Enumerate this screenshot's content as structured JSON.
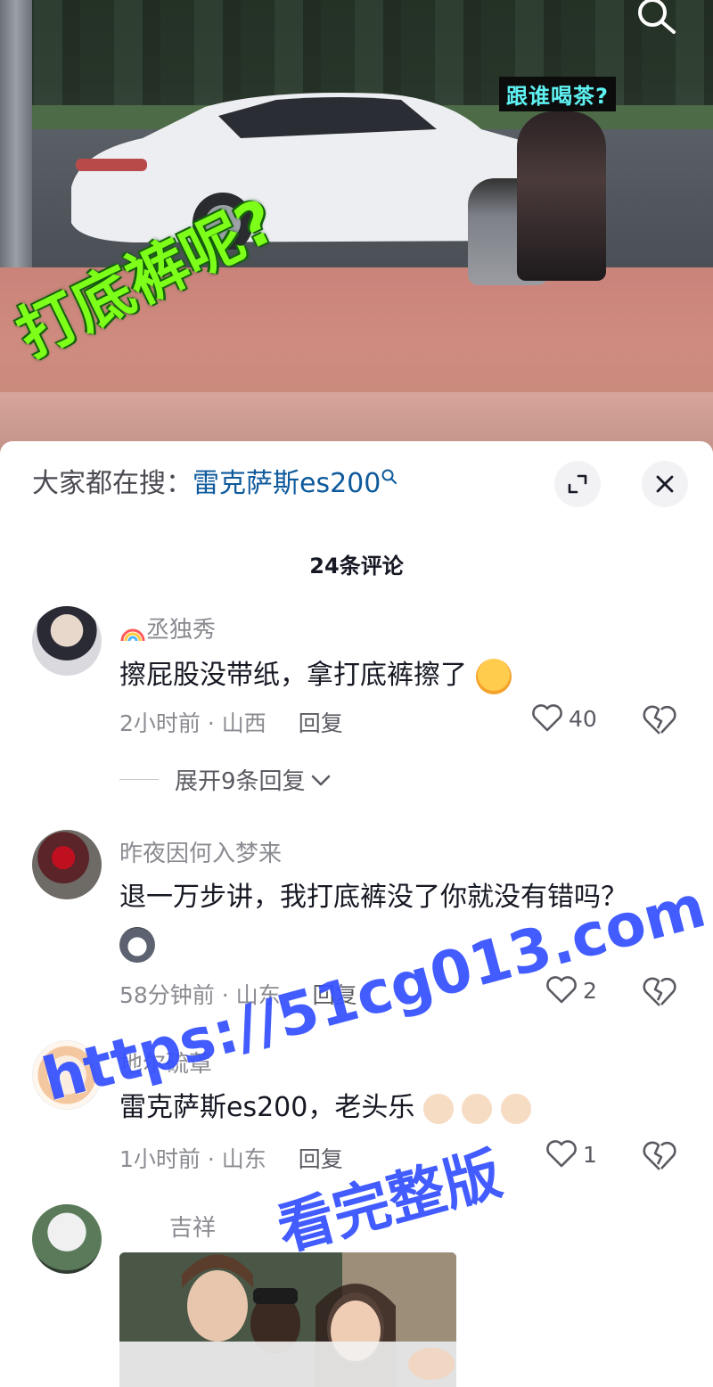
{
  "video": {
    "sticker_text": "跟谁喝茶?",
    "overlay_text": "打底裤呢?"
  },
  "search_bar": {
    "prefix": "大家都在搜：",
    "term": "雷克萨斯es200"
  },
  "comments_header": {
    "count_label": "24条评论"
  },
  "comments": [
    {
      "username": "丞独秀",
      "text": "擦屁股没带纸，拿打底裤擦了",
      "time_location": "2小时前 · 山西",
      "reply_label": "回复",
      "likes": "40",
      "expand_label": "展开9条回复"
    },
    {
      "username": "昨夜因何入梦来",
      "text": "退一万步讲，我打底裤没了你就没有错吗？",
      "time_location": "58分钟前 · 山东",
      "reply_label": "回复",
      "likes": "2"
    },
    {
      "username": "地尔硫䓬",
      "text": "雷克萨斯es200，老头乐",
      "time_location": "1小时前 · 山东",
      "reply_label": "回复",
      "likes": "1"
    },
    {
      "username": "吉祥"
    }
  ],
  "watermark": {
    "url": "https://51cg013.com",
    "tagline": "看完整版"
  },
  "colors": {
    "accent_link": "#0e5a9c",
    "text_primary": "#161823",
    "text_secondary": "#8a8b91",
    "watermark_blue": "#2846ff",
    "overlay_green": "#7dff1a"
  }
}
